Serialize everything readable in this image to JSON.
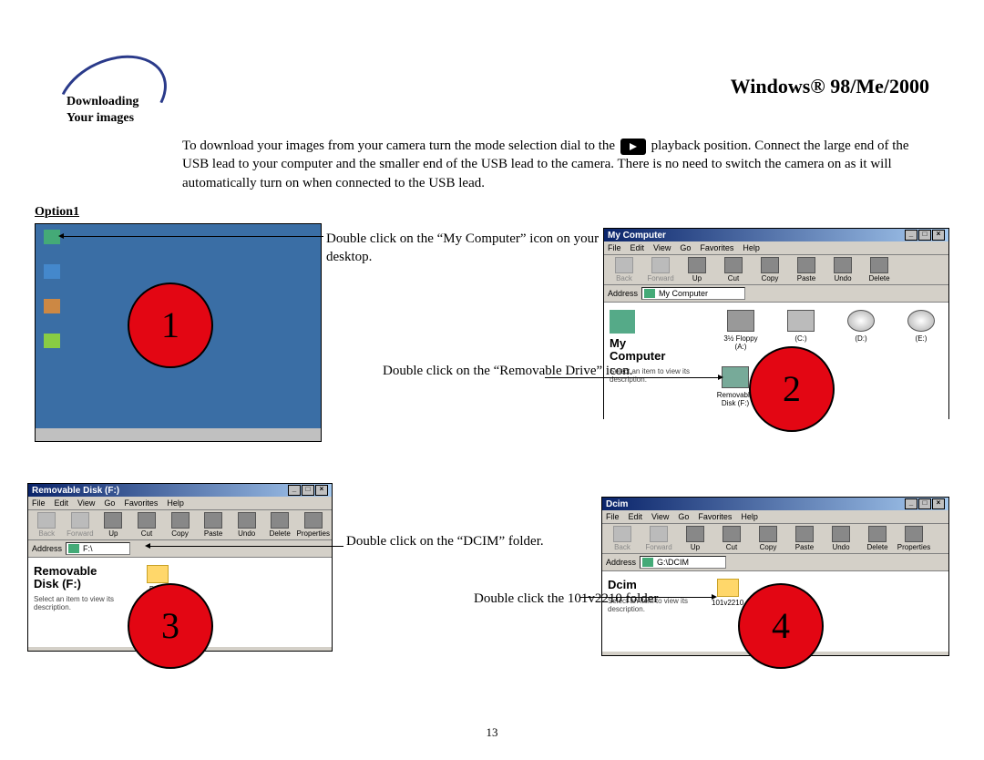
{
  "page_title": "Windows® 98/Me/2000",
  "logo": {
    "line1": "Downloading",
    "line2": "Your images"
  },
  "intro": {
    "part1": "To download your images from your camera turn the mode selection dial to the ",
    "part2": "playback position. Connect the large end of the USB lead to your computer and the smaller end of the USB lead to the camera. There is no need to switch the camera on as it will automatically turn on when connected to the USB lead."
  },
  "option_label": "Option1",
  "captions": {
    "c1": "Double click on the “My Computer” icon on your desktop.",
    "c2": "Double click on the “Removable Drive” icon.",
    "c3": "Double click on the “DCIM” folder.",
    "c4": "Double click the 101v2210 folder"
  },
  "steps": {
    "s1": "1",
    "s2": "2",
    "s3": "3",
    "s4": "4"
  },
  "win2": {
    "title": "My Computer",
    "addr": "My Computer",
    "left_title": "My\nComputer",
    "left_sub": "Select an item to view its description.",
    "drives": [
      {
        "label": "3½ Floppy (A:)",
        "cls": "floppy"
      },
      {
        "label": "(C:)",
        "cls": ""
      },
      {
        "label": "(D:)",
        "cls": "cd"
      },
      {
        "label": "(E:)",
        "cls": "cd"
      }
    ],
    "removable": "Removable Disk (F:)"
  },
  "win3": {
    "title": "Removable Disk (F:)",
    "addr": "F:\\",
    "left_title": "Removable\nDisk (F:)",
    "left_sub": "Select an item to view its description.",
    "folder": "Dcim"
  },
  "win4": {
    "title": "Dcim",
    "addr": "G:\\DCIM",
    "left_title": "Dcim",
    "left_sub": "Select an item to view its description.",
    "folder": "101v2210"
  },
  "menus": [
    "File",
    "Edit",
    "View",
    "Go",
    "Favorites",
    "Help"
  ],
  "toolbar": [
    "Back",
    "Forward",
    "Up",
    "Cut",
    "Copy",
    "Paste",
    "Undo",
    "Delete"
  ],
  "toolbar_ext": [
    "Back",
    "Forward",
    "Up",
    "Cut",
    "Copy",
    "Paste",
    "Undo",
    "Delete",
    "Properties"
  ],
  "addr_label": "Address",
  "page_number": "13"
}
